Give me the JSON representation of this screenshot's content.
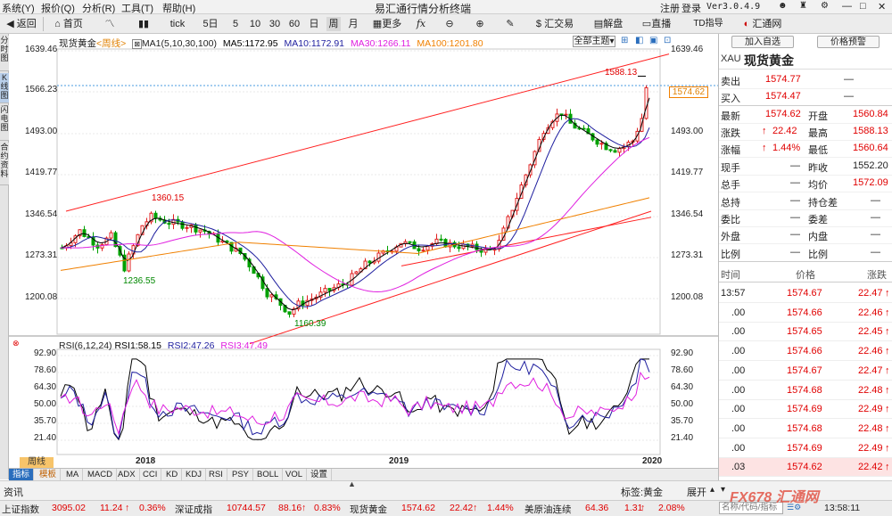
{
  "menu": {
    "system": "系统(Y)",
    "quote": "报价(Q)",
    "analysis": "分析(R)",
    "tools": "工具(T)",
    "help": "帮助(H)",
    "title": "易汇通行情分析终端",
    "notice": "注册",
    "login": "登录",
    "version": "Ver3.0.4.9"
  },
  "toolbar": {
    "back": "返回",
    "home": "首页",
    "tick": "tick",
    "d5": "5日",
    "m10": "10",
    "m30": "30",
    "m60": "60",
    "day": "日",
    "week": "周",
    "month": "月",
    "more": "更多",
    "fx": "汇交易",
    "unlock": "解盘",
    "live": "直播",
    "td": "TD指导",
    "hwt": "汇通网"
  },
  "sidetabs": [
    "分时图",
    "K线图",
    "闪电图",
    "合约资料"
  ],
  "chart": {
    "legend1": {
      "name": "现货黄金",
      "period": "<周线>",
      "ma": "MA1(5,10,30,100)",
      "ma5": "MA5:1172.95",
      "ma10": "MA10:1172.91",
      "ma30": "MA30:1266.11",
      "ma100": "MA100:1201.80"
    },
    "theme": "全部主题",
    "yaxis_left": [
      "1639.46",
      "1566.23",
      "1493.00",
      "1419.77",
      "1346.54",
      "1273.31",
      "1200.08"
    ],
    "yaxis_right": [
      "1639.46",
      "1566.23",
      "1493.00",
      "1419.77",
      "1346.54",
      "1273.31",
      "1200.08"
    ],
    "price_tag": "1574.62",
    "annotations": {
      "high": "1588.13",
      "h2018": "1360.15",
      "low1": "1236.55",
      "low2": "1160.39"
    },
    "rsi_legend": {
      "name": "RSI(6,12,24)",
      "r1": "RSI1:58.15",
      "r2": "RSI2:47.26",
      "r3": "RSI3:47.49"
    },
    "rsi_axis": [
      "92.90",
      "78.60",
      "64.30",
      "50.00",
      "35.70",
      "21.40"
    ],
    "xaxis": [
      "2018",
      "2019",
      "2020"
    ],
    "period_badge": "周线",
    "colors": {
      "up": "#e02020",
      "down": "#00a000",
      "ma5": "#000000",
      "ma10": "#1f1f9f",
      "ma30": "#e020e0",
      "ma100": "#f08000",
      "trend": "#ff2020",
      "crosshair": "#4a9be0"
    }
  },
  "bottomtabs": [
    "指标",
    "模板",
    "MA",
    "MACD",
    "ADX",
    "CCI",
    "KD",
    "KDJ",
    "RSI",
    "PSY",
    "BOLL",
    "VOL",
    "设置"
  ],
  "right": {
    "add_watch": "加入自选",
    "alert": "价格预警",
    "symbol": "XAU",
    "name": "现货黄金",
    "bid_label": "卖出",
    "bid": "1574.77",
    "bid_v": "—",
    "ask_label": "买入",
    "ask": "1574.47",
    "ask_v": "—",
    "latest_label": "最新",
    "latest": "1574.62",
    "open_label": "开盘",
    "open": "1560.84",
    "chg_label": "涨跌",
    "chg": "22.42",
    "high_label": "最高",
    "high": "1588.13",
    "pct_label": "涨幅",
    "pct": "1.44%",
    "low_label": "最低",
    "low": "1560.64",
    "now_label": "现手",
    "now": "—",
    "prev_label": "昨收",
    "prev": "1552.20",
    "total_label": "总手",
    "total": "—",
    "avg_label": "均价",
    "avg": "1572.09",
    "hold_label": "总持",
    "hold": "—",
    "hold_chg_label": "持仓差",
    "hold_chg": "—",
    "ratio_label": "委比",
    "ratio": "—",
    "diff_label": "委差",
    "diff": "—",
    "out_label": "外盘",
    "out": "—",
    "in_label": "内盘",
    "in": "—",
    "bili_label": "比例",
    "bili": "—",
    "bili2_label": "比例",
    "bili2": "—",
    "ticks_header": {
      "time": "时间",
      "price": "价格",
      "chg": "涨跌"
    },
    "ticks": [
      {
        "t": "13:57",
        "p": "1574.67",
        "c": "22.47"
      },
      {
        "t": ".00",
        "p": "1574.66",
        "c": "22.46"
      },
      {
        "t": ".00",
        "p": "1574.65",
        "c": "22.45"
      },
      {
        "t": ".00",
        "p": "1574.66",
        "c": "22.46"
      },
      {
        "t": ".00",
        "p": "1574.67",
        "c": "22.47"
      },
      {
        "t": ".00",
        "p": "1574.68",
        "c": "22.48"
      },
      {
        "t": ".00",
        "p": "1574.69",
        "c": "22.49"
      },
      {
        "t": ".00",
        "p": "1574.68",
        "c": "22.48"
      },
      {
        "t": ".00",
        "p": "1574.69",
        "c": "22.49"
      },
      {
        "t": ".03",
        "p": "1574.62",
        "c": "22.42"
      }
    ]
  },
  "infobar": {
    "info": "资讯",
    "tag": "标签:黄金",
    "expand": "展开"
  },
  "status": {
    "sh_label": "上证指数",
    "sh": "3095.02",
    "sh_chg": "11.24",
    "sh_pct": "0.36%",
    "sz_label": "深证成指",
    "sz": "10744.57",
    "sz_chg": "88.16",
    "sz_pct": "0.83%",
    "gold_label": "现货黄金",
    "gold": "1574.62",
    "gold_chg": "22.42",
    "gold_pct": "1.44%",
    "oil_label": "美原油连续",
    "oil": "64.36",
    "oil_chg": "1.31",
    "oil_pct": "2.08%",
    "search_ph": "名称/代码/指标",
    "time": "13:58:11",
    "brand": "FX678 汇通网"
  }
}
